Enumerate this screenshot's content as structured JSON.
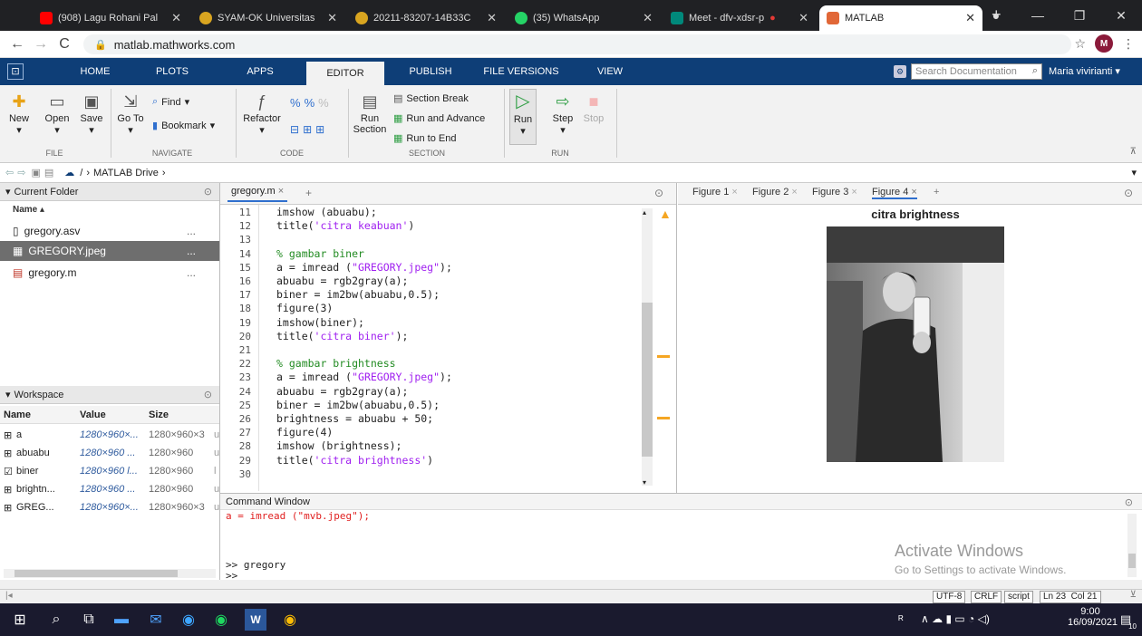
{
  "browser": {
    "tabs": [
      {
        "label": "(908) Lagu Rohani Pal",
        "color": "#ff0000"
      },
      {
        "label": "SYAM-OK Universitas",
        "color": "#d9a520"
      },
      {
        "label": "20211-83207-14B33C",
        "color": "#d9a520"
      },
      {
        "label": "(35) WhatsApp",
        "color": "#25d366"
      },
      {
        "label": "Meet - dfv-xdsr-p",
        "color": "#00897b"
      },
      {
        "label": "MATLAB",
        "color": "#e16737"
      }
    ],
    "new_tab": "+",
    "url": "matlab.mathworks.com",
    "avatar": "M"
  },
  "matlab": {
    "tabs": [
      "HOME",
      "PLOTS",
      "APPS",
      "EDITOR",
      "PUBLISH",
      "FILE VERSIONS",
      "VIEW"
    ],
    "search_placeholder": "Search Documentation",
    "user": "Maria vivirianti"
  },
  "toolstrip": {
    "file": {
      "new": "New",
      "open": "Open",
      "save": "Save",
      "group": "FILE"
    },
    "navigate": {
      "goto": "Go To",
      "find": "Find",
      "bookmark": "Bookmark",
      "group": "NAVIGATE"
    },
    "code": {
      "refactor": "Refactor",
      "group": "CODE"
    },
    "section": {
      "run_section_1": "Run",
      "run_section_2": "Section",
      "section_break": "Section Break",
      "run_advance": "Run and Advance",
      "run_to_end": "Run to End",
      "group": "SECTION"
    },
    "run": {
      "run": "Run",
      "step": "Step",
      "stop": "Stop",
      "group": "RUN"
    }
  },
  "path": {
    "root": "/",
    "drive": "MATLAB Drive"
  },
  "current_folder": {
    "title": "Current Folder",
    "column": "Name",
    "files": [
      {
        "name": "gregory.asv",
        "more": "..."
      },
      {
        "name": "GREGORY.jpeg",
        "more": "..."
      },
      {
        "name": "gregory.m",
        "more": "..."
      }
    ]
  },
  "workspace": {
    "title": "Workspace",
    "columns": [
      "Name",
      "Value",
      "Size"
    ],
    "rows": [
      {
        "name": "a",
        "value": "1280×960×...",
        "size": "1280×960×3",
        "cls": "u"
      },
      {
        "name": "abuabu",
        "value": "1280×960 ...",
        "size": "1280×960",
        "cls": "u"
      },
      {
        "name": "biner",
        "value": "1280×960 l...",
        "size": "1280×960",
        "cls": "l"
      },
      {
        "name": "brightn...",
        "value": "1280×960 ...",
        "size": "1280×960",
        "cls": "u"
      },
      {
        "name": "GREG...",
        "value": "1280×960×...",
        "size": "1280×960×3",
        "cls": "u"
      }
    ]
  },
  "editor": {
    "tab": "gregory.m",
    "lines": [
      {
        "n": "11",
        "code": "imshow (abuabu);"
      },
      {
        "n": "12",
        "code": "title('citra keabuan')"
      },
      {
        "n": "13",
        "code": ""
      },
      {
        "n": "14",
        "code": "% gambar biner"
      },
      {
        "n": "15",
        "code": "a = imread (\"GREGORY.jpeg\");"
      },
      {
        "n": "16",
        "code": "abuabu = rgb2gray(a);"
      },
      {
        "n": "17",
        "code": "biner = im2bw(abuabu,0.5);"
      },
      {
        "n": "18",
        "code": "figure(3)"
      },
      {
        "n": "19",
        "code": "imshow(biner);"
      },
      {
        "n": "20",
        "code": "title('citra biner');"
      },
      {
        "n": "21",
        "code": ""
      },
      {
        "n": "22",
        "code": "% gambar brightness"
      },
      {
        "n": "23",
        "code": "a = imread (\"GREGORY.jpeg\");"
      },
      {
        "n": "24",
        "code": "abuabu = rgb2gray(a);"
      },
      {
        "n": "25",
        "code": "biner = im2bw(abuabu,0.5);"
      },
      {
        "n": "26",
        "code": "brightness = abuabu + 50;"
      },
      {
        "n": "27",
        "code": "figure(4)"
      },
      {
        "n": "28",
        "code": "imshow (brightness);"
      },
      {
        "n": "29",
        "code": "title('citra brightness')"
      },
      {
        "n": "30",
        "code": ""
      }
    ]
  },
  "figures": {
    "tabs": [
      "Figure 1",
      "Figure 2",
      "Figure 3",
      "Figure 4"
    ],
    "title": "citra brightness"
  },
  "command_window": {
    "title": "Command Window",
    "error_line": "a = imread (\"mvb.jpeg\");",
    "line1": ">> gregory",
    "line2": ">>"
  },
  "watermark": {
    "title": "Activate Windows",
    "subtitle": "Go to Settings to activate Windows."
  },
  "status": {
    "encoding": "UTF-8",
    "eol": "CRLF",
    "type": "script",
    "position": "Ln 23  Col 21"
  },
  "taskbar": {
    "time": "9:00",
    "date": "16/09/2021",
    "notify": "10"
  }
}
